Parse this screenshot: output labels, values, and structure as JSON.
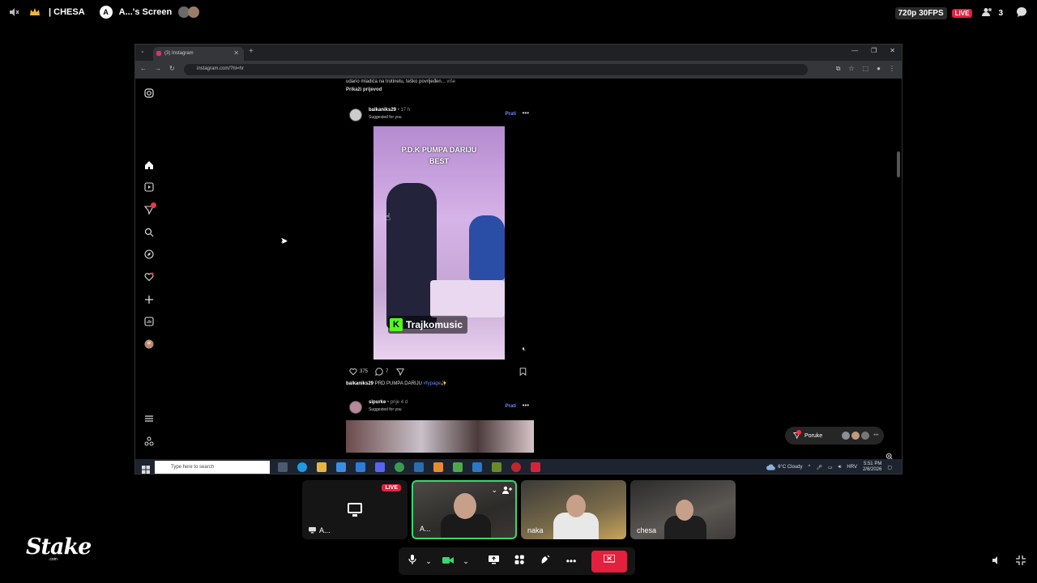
{
  "topbar": {
    "channel": "| CHESA",
    "screen_owner": "A...'s Screen",
    "quality": "720p 30FPS",
    "live": "LIVE",
    "viewer_count": "3"
  },
  "browser": {
    "tab_title": "(3) Instagram",
    "url": "instagram.com/?hl=hr"
  },
  "instagram": {
    "prev_caption": "udario mladića na trotinetu, teško povrijeđen...",
    "prev_more": "više",
    "translate": "Prikaži prijevod",
    "post1": {
      "username": "balkaniks29",
      "time": "• 17 h",
      "subtitle": "Suggested for you",
      "follow": "Prati",
      "video_title_line1": "P.D.K PUMPA DARIJU",
      "video_title_line2": "BEST",
      "watermark": "Trajkomusic",
      "likes": "375",
      "comments": "7",
      "caption_user": "balkaniks29",
      "caption_text": "PRD PUMPA DARIJU",
      "caption_tag": "#fypage✨"
    },
    "post2": {
      "username": "sipurke",
      "time": "• prije 4 d",
      "subtitle": "Suggested for you",
      "follow": "Prati"
    },
    "messages_label": "Poruke",
    "notif_badge": "3"
  },
  "taskbar": {
    "search_placeholder": "Type here to search",
    "weather": "6°C Cloudy",
    "lang": "HRV",
    "time": "5:51 PM",
    "date": "2/8/2026"
  },
  "participants": [
    {
      "name": "A...",
      "type": "screen",
      "live": "LIVE"
    },
    {
      "name": "A..."
    },
    {
      "name": "naka"
    },
    {
      "name": "chesa"
    }
  ],
  "brand": {
    "logo_text": "Stake",
    "logo_sub": ".com"
  },
  "colors": {
    "live_red": "#e3203e",
    "speaking_green": "#3bd671",
    "kick_green": "#53fc18",
    "ig_link_blue": "#6b8cff"
  }
}
